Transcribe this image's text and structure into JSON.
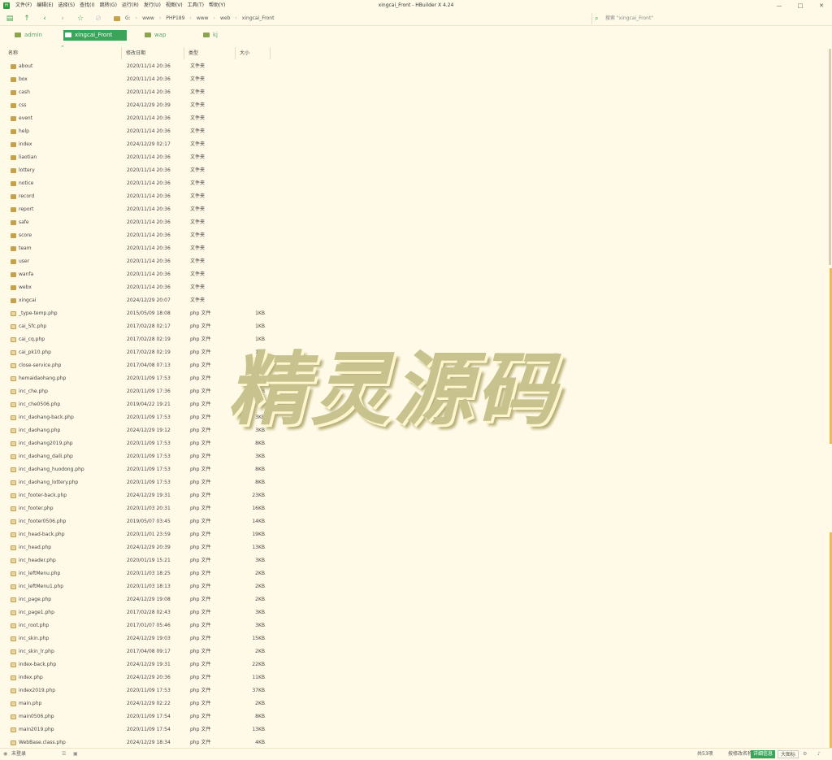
{
  "window": {
    "title": "xingcai_Front - HBuilder X 4.24",
    "app_icon_text": "H",
    "controls": [
      "—",
      "□",
      "✕"
    ]
  },
  "menu": [
    "文件(F)",
    "编辑(E)",
    "选择(S)",
    "查找(I)",
    "跳转(G)",
    "运行(R)",
    "发行(U)",
    "视图(V)",
    "工具(T)",
    "帮助(Y)"
  ],
  "toolbar": {
    "breadcrumbs": [
      "G:",
      "www",
      "PHP189",
      "www",
      "web",
      "xingcai_Front"
    ],
    "search_placeholder": "搜索 \"xingcai_Front\""
  },
  "favorites": [
    {
      "label": "admin",
      "active": false
    },
    {
      "label": "xingcai_Front",
      "active": true
    },
    {
      "label": "wap",
      "active": false
    },
    {
      "label": "kj",
      "active": false
    }
  ],
  "columns": {
    "name": "名称",
    "date": "修改日期",
    "type": "类型",
    "size": "大小"
  },
  "files": [
    {
      "name": "about",
      "date": "2020/11/14 20:36",
      "type": "文件夹",
      "size": "",
      "kind": "folder"
    },
    {
      "name": "box",
      "date": "2020/11/14 20:36",
      "type": "文件夹",
      "size": "",
      "kind": "folder"
    },
    {
      "name": "cash",
      "date": "2020/11/14 20:36",
      "type": "文件夹",
      "size": "",
      "kind": "folder"
    },
    {
      "name": "css",
      "date": "2024/12/29 20:39",
      "type": "文件夹",
      "size": "",
      "kind": "folder"
    },
    {
      "name": "event",
      "date": "2020/11/14 20:36",
      "type": "文件夹",
      "size": "",
      "kind": "folder"
    },
    {
      "name": "help",
      "date": "2020/11/14 20:36",
      "type": "文件夹",
      "size": "",
      "kind": "folder"
    },
    {
      "name": "index",
      "date": "2024/12/29 02:17",
      "type": "文件夹",
      "size": "",
      "kind": "folder"
    },
    {
      "name": "liaotian",
      "date": "2020/11/14 20:36",
      "type": "文件夹",
      "size": "",
      "kind": "folder"
    },
    {
      "name": "lottery",
      "date": "2020/11/14 20:36",
      "type": "文件夹",
      "size": "",
      "kind": "folder"
    },
    {
      "name": "notice",
      "date": "2020/11/14 20:36",
      "type": "文件夹",
      "size": "",
      "kind": "folder"
    },
    {
      "name": "record",
      "date": "2020/11/14 20:36",
      "type": "文件夹",
      "size": "",
      "kind": "folder"
    },
    {
      "name": "report",
      "date": "2020/11/14 20:36",
      "type": "文件夹",
      "size": "",
      "kind": "folder"
    },
    {
      "name": "safe",
      "date": "2020/11/14 20:36",
      "type": "文件夹",
      "size": "",
      "kind": "folder"
    },
    {
      "name": "score",
      "date": "2020/11/14 20:36",
      "type": "文件夹",
      "size": "",
      "kind": "folder"
    },
    {
      "name": "team",
      "date": "2020/11/14 20:36",
      "type": "文件夹",
      "size": "",
      "kind": "folder"
    },
    {
      "name": "user",
      "date": "2020/11/14 20:36",
      "type": "文件夹",
      "size": "",
      "kind": "folder"
    },
    {
      "name": "wanfa",
      "date": "2020/11/14 20:36",
      "type": "文件夹",
      "size": "",
      "kind": "folder"
    },
    {
      "name": "webx",
      "date": "2020/11/14 20:36",
      "type": "文件夹",
      "size": "",
      "kind": "folder"
    },
    {
      "name": "xingcai",
      "date": "2024/12/29 20:07",
      "type": "文件夹",
      "size": "",
      "kind": "folder"
    },
    {
      "name": "_type-temp.php",
      "date": "2015/05/09 18:08",
      "type": "php 文件",
      "size": "1KB",
      "kind": "file"
    },
    {
      "name": "cai_5fc.php",
      "date": "2017/02/28 02:17",
      "type": "php 文件",
      "size": "1KB",
      "kind": "file"
    },
    {
      "name": "cai_cq.php",
      "date": "2017/02/28 02:19",
      "type": "php 文件",
      "size": "1KB",
      "kind": "file"
    },
    {
      "name": "cai_pk10.php",
      "date": "2017/02/28 02:19",
      "type": "php 文件",
      "size": "1KB",
      "kind": "file"
    },
    {
      "name": "close-service.php",
      "date": "2017/04/08 07:13",
      "type": "php 文件",
      "size": "2KB",
      "kind": "file"
    },
    {
      "name": "hemaidaohang.php",
      "date": "2020/11/09 17:53",
      "type": "php 文件",
      "size": "2KB",
      "kind": "file"
    },
    {
      "name": "inc_che.php",
      "date": "2020/11/09 17:36",
      "type": "php 文件",
      "size": "15KB",
      "kind": "file"
    },
    {
      "name": "inc_che0506.php",
      "date": "2019/04/22 19:21",
      "type": "php 文件",
      "size": "14KB",
      "kind": "file"
    },
    {
      "name": "inc_daohang-back.php",
      "date": "2020/11/09 17:53",
      "type": "php 文件",
      "size": "3KB",
      "kind": "file"
    },
    {
      "name": "inc_daohang.php",
      "date": "2024/12/29 19:12",
      "type": "php 文件",
      "size": "3KB",
      "kind": "file"
    },
    {
      "name": "inc_daohang2019.php",
      "date": "2020/11/09 17:53",
      "type": "php 文件",
      "size": "8KB",
      "kind": "file"
    },
    {
      "name": "inc_daohang_daili.php",
      "date": "2020/11/09 17:53",
      "type": "php 文件",
      "size": "3KB",
      "kind": "file"
    },
    {
      "name": "inc_daohang_huodong.php",
      "date": "2020/11/09 17:53",
      "type": "php 文件",
      "size": "8KB",
      "kind": "file"
    },
    {
      "name": "inc_daohang_lottery.php",
      "date": "2020/11/09 17:53",
      "type": "php 文件",
      "size": "8KB",
      "kind": "file"
    },
    {
      "name": "inc_footer-back.php",
      "date": "2024/12/29 19:31",
      "type": "php 文件",
      "size": "23KB",
      "kind": "file"
    },
    {
      "name": "inc_footer.php",
      "date": "2020/11/03 20:31",
      "type": "php 文件",
      "size": "16KB",
      "kind": "file"
    },
    {
      "name": "inc_footer0506.php",
      "date": "2019/05/07 03:45",
      "type": "php 文件",
      "size": "14KB",
      "kind": "file"
    },
    {
      "name": "inc_head-back.php",
      "date": "2020/11/01 23:59",
      "type": "php 文件",
      "size": "19KB",
      "kind": "file"
    },
    {
      "name": "inc_head.php",
      "date": "2024/12/29 20:39",
      "type": "php 文件",
      "size": "13KB",
      "kind": "file"
    },
    {
      "name": "inc_header.php",
      "date": "2020/01/19 15:21",
      "type": "php 文件",
      "size": "3KB",
      "kind": "file"
    },
    {
      "name": "inc_leftMenu.php",
      "date": "2020/11/03 18:25",
      "type": "php 文件",
      "size": "2KB",
      "kind": "file"
    },
    {
      "name": "inc_leftMenu1.php",
      "date": "2020/11/03 18:13",
      "type": "php 文件",
      "size": "2KB",
      "kind": "file"
    },
    {
      "name": "inc_page.php",
      "date": "2024/12/29 19:08",
      "type": "php 文件",
      "size": "2KB",
      "kind": "file"
    },
    {
      "name": "inc_page1.php",
      "date": "2017/02/28 02:43",
      "type": "php 文件",
      "size": "3KB",
      "kind": "file"
    },
    {
      "name": "inc_root.php",
      "date": "2017/01/07 05:46",
      "type": "php 文件",
      "size": "3KB",
      "kind": "file"
    },
    {
      "name": "inc_skin.php",
      "date": "2024/12/29 19:03",
      "type": "php 文件",
      "size": "15KB",
      "kind": "file"
    },
    {
      "name": "inc_skin_lr.php",
      "date": "2017/04/08 09:17",
      "type": "php 文件",
      "size": "2KB",
      "kind": "file"
    },
    {
      "name": "index-back.php",
      "date": "2024/12/29 19:31",
      "type": "php 文件",
      "size": "22KB",
      "kind": "file"
    },
    {
      "name": "index.php",
      "date": "2024/12/29 20:36",
      "type": "php 文件",
      "size": "11KB",
      "kind": "file"
    },
    {
      "name": "index2019.php",
      "date": "2020/11/09 17:53",
      "type": "php 文件",
      "size": "37KB",
      "kind": "file"
    },
    {
      "name": "main.php",
      "date": "2024/12/29 02:22",
      "type": "php 文件",
      "size": "2KB",
      "kind": "file"
    },
    {
      "name": "main0506.php",
      "date": "2020/11/09 17:54",
      "type": "php 文件",
      "size": "8KB",
      "kind": "file"
    },
    {
      "name": "main2019.php",
      "date": "2020/11/09 17:54",
      "type": "php 文件",
      "size": "13KB",
      "kind": "file"
    },
    {
      "name": "WebBase.class.php",
      "date": "2024/12/29 18:34",
      "type": "php 文件",
      "size": "4KB",
      "kind": "file"
    }
  ],
  "watermark": "精灵源码",
  "status": {
    "login": "未登录",
    "count": "共53项",
    "sort": "按修改名称 ↑",
    "detail": "详细信息",
    "icons": "大图标"
  },
  "colors": {
    "accent": "#3aa55a",
    "background": "#fffae8",
    "folder": "#c5a24a"
  }
}
